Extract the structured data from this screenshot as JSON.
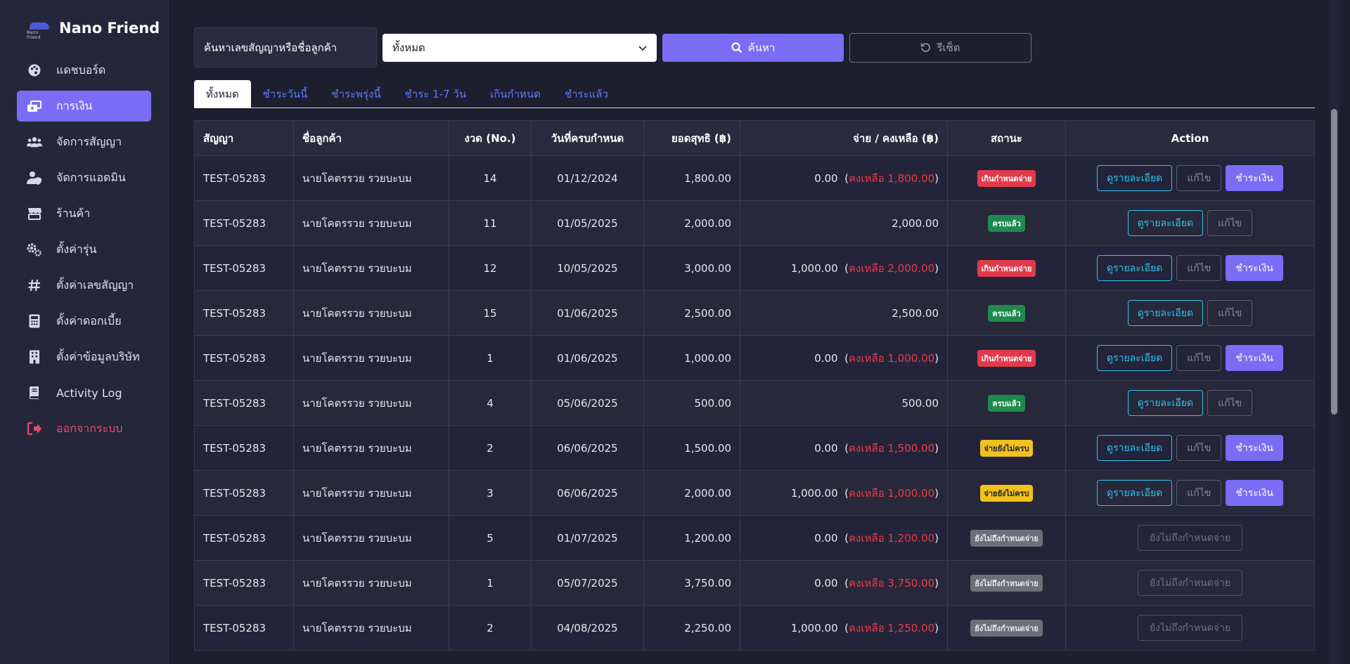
{
  "brand": {
    "name": "Nano Friend",
    "logo_text": "Nano Friend"
  },
  "sidebar": {
    "items": [
      {
        "label": "แดชบอร์ด",
        "icon": "palette-icon",
        "active": false
      },
      {
        "label": "การเงิน",
        "icon": "money-icon",
        "active": true
      },
      {
        "label": "จัดการสัญญา",
        "icon": "users-icon",
        "active": false
      },
      {
        "label": "จัดการแอดมิน",
        "icon": "user-shield-icon",
        "active": false
      },
      {
        "label": "ร้านค้า",
        "icon": "store-icon",
        "active": false
      },
      {
        "label": "ตั้งค่ารุ่น",
        "icon": "gears-icon",
        "active": false
      },
      {
        "label": "ตั้งค่าเลขสัญญา",
        "icon": "hash-icon",
        "active": false
      },
      {
        "label": "ตั้งค่าดอกเบี้ย",
        "icon": "calculator-icon",
        "active": false
      },
      {
        "label": "ตั้งค่าข้อมูลบริษัท",
        "icon": "building-icon",
        "active": false
      },
      {
        "label": "Activity Log",
        "icon": "book-icon",
        "active": false
      }
    ],
    "logout": {
      "label": "ออกจากระบบ",
      "icon": "logout-icon"
    }
  },
  "search": {
    "label": "ค้นหาเลขสัญญาหรือชื่อลูกค้า",
    "select_value": "ทั้งหมด",
    "search_button": "ค้นหา",
    "reset_button": "รีเซ็ต"
  },
  "tabs": [
    {
      "label": "ทั้งหมด",
      "active": true
    },
    {
      "label": "ชำระวันนี้",
      "active": false
    },
    {
      "label": "ชำระพรุ่งนี้",
      "active": false
    },
    {
      "label": "ชำระ 1-7 วัน",
      "active": false
    },
    {
      "label": "เกินกำหนด",
      "active": false
    },
    {
      "label": "ชำระแล้ว",
      "active": false
    }
  ],
  "table": {
    "headers": {
      "contract": "สัญญา",
      "customer": "ชื่อลูกค้า",
      "installment": "งวด (No.)",
      "due_date": "วันที่ครบกำหนด",
      "net": "ยอดสุทธิ (฿)",
      "paid_remaining": "จ่าย / คงเหลือ (฿)",
      "status": "สถานะ",
      "action": "Action"
    },
    "labels": {
      "detail": "ดูรายละเอียด",
      "edit": "แก้ไข",
      "pay": "ชำระเงิน",
      "not_due": "ยังไม่ถึงกำหนดจ่าย"
    },
    "rows": [
      {
        "contract": "TEST-05283",
        "customer": "นายโคตรรวย รวยบะบม",
        "installment": "14",
        "due_date": "01/12/2024",
        "net": "1,800.00",
        "paid": "0.00",
        "remaining": "คงเหลือ 1,800.00",
        "status": "เกินกำหนดจ่าย",
        "status_type": "overdue",
        "actions": "full"
      },
      {
        "contract": "TEST-05283",
        "customer": "นายโคตรรวย รวยบะบม",
        "installment": "11",
        "due_date": "01/05/2025",
        "net": "2,000.00",
        "paid": "2,000.00",
        "remaining": "",
        "status": "ครบแล้ว",
        "status_type": "paid",
        "actions": "view"
      },
      {
        "contract": "TEST-05283",
        "customer": "นายโคตรรวย รวยบะบม",
        "installment": "12",
        "due_date": "10/05/2025",
        "net": "3,000.00",
        "paid": "1,000.00",
        "remaining": "คงเหลือ 2,000.00",
        "status": "เกินกำหนดจ่าย",
        "status_type": "overdue",
        "actions": "full"
      },
      {
        "contract": "TEST-05283",
        "customer": "นายโคตรรวย รวยบะบม",
        "installment": "15",
        "due_date": "01/06/2025",
        "net": "2,500.00",
        "paid": "2,500.00",
        "remaining": "",
        "status": "ครบแล้ว",
        "status_type": "paid",
        "actions": "view"
      },
      {
        "contract": "TEST-05283",
        "customer": "นายโคตรรวย รวยบะบม",
        "installment": "1",
        "due_date": "01/06/2025",
        "net": "1,000.00",
        "paid": "0.00",
        "remaining": "คงเหลือ 1,000.00",
        "status": "เกินกำหนดจ่าย",
        "status_type": "overdue",
        "actions": "full"
      },
      {
        "contract": "TEST-05283",
        "customer": "นายโคตรรวย รวยบะบม",
        "installment": "4",
        "due_date": "05/06/2025",
        "net": "500.00",
        "paid": "500.00",
        "remaining": "",
        "status": "ครบแล้ว",
        "status_type": "paid",
        "actions": "view"
      },
      {
        "contract": "TEST-05283",
        "customer": "นายโคตรรวย รวยบะบม",
        "installment": "2",
        "due_date": "06/06/2025",
        "net": "1,500.00",
        "paid": "0.00",
        "remaining": "คงเหลือ 1,500.00",
        "status": "จ่ายยังไม่ครบ",
        "status_type": "partial",
        "actions": "full"
      },
      {
        "contract": "TEST-05283",
        "customer": "นายโคตรรวย รวยบะบม",
        "installment": "3",
        "due_date": "06/06/2025",
        "net": "2,000.00",
        "paid": "1,000.00",
        "remaining": "คงเหลือ 1,000.00",
        "status": "จ่ายยังไม่ครบ",
        "status_type": "partial",
        "actions": "full"
      },
      {
        "contract": "TEST-05283",
        "customer": "นายโคตรรวย รวยบะบม",
        "installment": "5",
        "due_date": "01/07/2025",
        "net": "1,200.00",
        "paid": "0.00",
        "remaining": "คงเหลือ 1,200.00",
        "status": "ยังไม่ถึงกำหนดจ่าย",
        "status_type": "notdue",
        "actions": "notdue"
      },
      {
        "contract": "TEST-05283",
        "customer": "นายโคตรรวย รวยบะบม",
        "installment": "1",
        "due_date": "05/07/2025",
        "net": "3,750.00",
        "paid": "0.00",
        "remaining": "คงเหลือ 3,750.00",
        "status": "ยังไม่ถึงกำหนดจ่าย",
        "status_type": "notdue",
        "actions": "notdue"
      },
      {
        "contract": "TEST-05283",
        "customer": "นายโคตรรวย รวยบะบม",
        "installment": "2",
        "due_date": "04/08/2025",
        "net": "2,250.00",
        "paid": "1,000.00",
        "remaining": "คงเหลือ 1,250.00",
        "status": "ยังไม่ถึงกำหนดจ่าย",
        "status_type": "notdue",
        "actions": "notdue"
      }
    ]
  },
  "colors": {
    "accent": "#7b6cf6",
    "link": "#5a7cff",
    "danger": "#ee3a4a",
    "background": "#1e1f2e"
  }
}
